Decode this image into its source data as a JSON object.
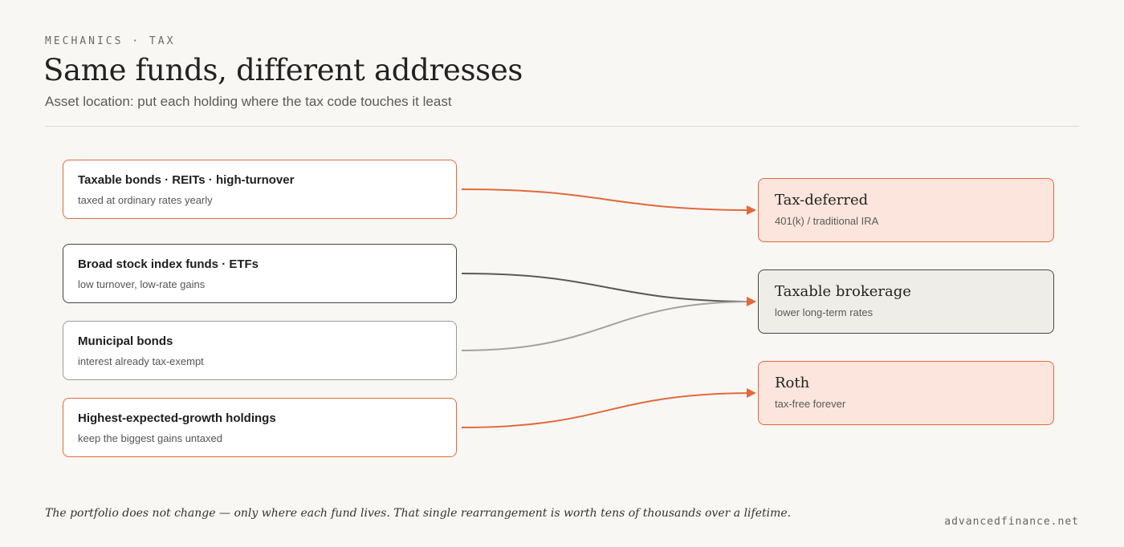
{
  "header": {
    "kicker": "MECHANICS · TAX",
    "title": "Same funds, different addresses",
    "subtitle": "Asset location: put each holding where the tax code touches it least"
  },
  "sources": [
    {
      "title": "Taxable bonds · REITs · high-turnover",
      "subtitle": "taxed at ordinary rates yearly"
    },
    {
      "title": "Broad stock index funds · ETFs",
      "subtitle": "low turnover, low-rate gains"
    },
    {
      "title": "Municipal bonds",
      "subtitle": "interest already tax-exempt"
    },
    {
      "title": "Highest-expected-growth holdings",
      "subtitle": "keep the biggest gains untaxed"
    }
  ],
  "destinations": [
    {
      "title": "Tax-deferred",
      "subtitle": "401(k) / traditional IRA"
    },
    {
      "title": "Taxable brokerage",
      "subtitle": "lower long-term rates"
    },
    {
      "title": "Roth",
      "subtitle": "tax-free forever"
    }
  ],
  "links": [
    {
      "from": 0,
      "to": 0,
      "color": "#e06a3c"
    },
    {
      "from": 1,
      "to": 1,
      "color": "#5a5a5a"
    },
    {
      "from": 2,
      "to": 1,
      "color": "#a3a29d"
    },
    {
      "from": 3,
      "to": 2,
      "color": "#e06a3c"
    }
  ],
  "colors": {
    "accent": "#e06a3c",
    "dark": "#444444",
    "muted": "#9a9a9a"
  },
  "footer": {
    "note": "The portfolio does not change — only where each fund lives. That single rearrangement is worth tens of thousands over a lifetime.",
    "brand": "advancedfinance.net"
  }
}
